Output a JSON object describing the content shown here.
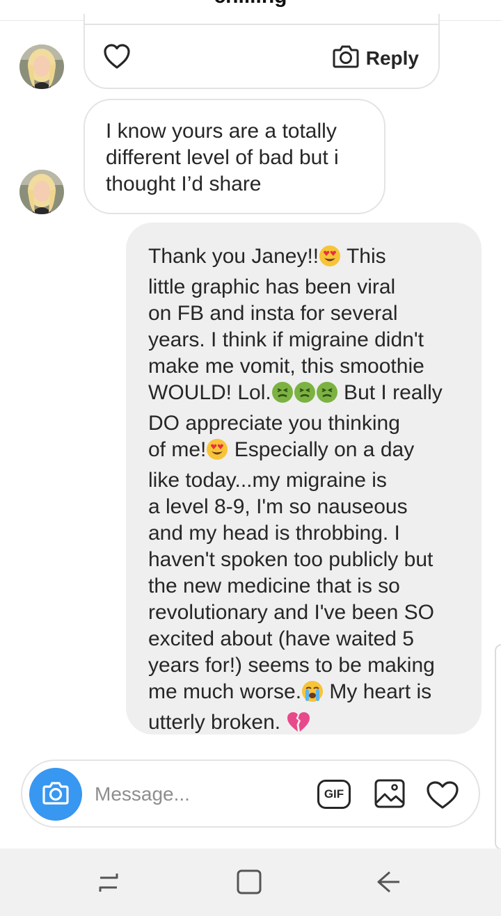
{
  "header": {
    "title": "chilling"
  },
  "thread": {
    "reply_card": {
      "reply_label": "Reply"
    },
    "incoming_message": {
      "lines": [
        "I know yours are a totally",
        "different level of bad but i",
        "thought I’d share"
      ]
    },
    "outgoing_message": {
      "lines": [
        {
          "text": "Thank you Janey!!",
          "emoji": "heart-eyes",
          "after": " This"
        },
        {
          "text": "little graphic has been viral"
        },
        {
          "text": "on FB and insta for several"
        },
        {
          "text": "years. I think if migraine didn't"
        },
        {
          "text": "make me vomit, this smoothie"
        },
        {
          "text": "WOULD! Lol.",
          "emoji": "nauseated-x3",
          "after": " But I really"
        },
        {
          "text": "DO appreciate you thinking"
        },
        {
          "text": "of me!",
          "emoji": "heart-eyes",
          "after": " Especially on a day"
        },
        {
          "text": "like today...my migraine is"
        },
        {
          "text": "a level 8-9, I'm so nauseous"
        },
        {
          "text": "and my head is throbbing. I"
        },
        {
          "text": "haven't spoken too publicly but"
        },
        {
          "text": "the new medicine that is so"
        },
        {
          "text": "revolutionary and I've been SO"
        },
        {
          "text": "excited about (have waited 5"
        },
        {
          "text": "years for!) seems to be making"
        },
        {
          "text": "me much worse.",
          "emoji": "crying",
          "after": " My heart is"
        },
        {
          "text": "utterly broken. ",
          "emoji": "broken-heart",
          "after": ""
        }
      ]
    }
  },
  "composer": {
    "placeholder": "Message...",
    "gif_label": "GIF"
  },
  "icons": {
    "heart": "heart-icon",
    "camera": "camera-icon",
    "gallery": "image-icon",
    "recent_apps": "recent-apps-icon",
    "home": "home-icon",
    "back": "back-icon"
  },
  "colors": {
    "accent": "#3897f0",
    "bubble_out": "#efefef",
    "border": "#e3e3e3",
    "navbar": "#f1f1f1"
  }
}
